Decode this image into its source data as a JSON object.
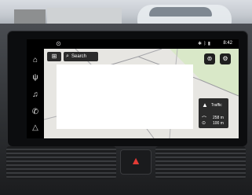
{
  "status_bar": {
    "time": "8:42",
    "icons": [
      "wifi-icon",
      "bluetooth-icon",
      "signal-icon"
    ]
  },
  "side_rail": {
    "items": [
      {
        "icon": "home-icon"
      },
      {
        "icon": "radio-icon"
      },
      {
        "icon": "music-icon"
      },
      {
        "icon": "phone-icon"
      },
      {
        "icon": "navigation-icon"
      }
    ]
  },
  "map": {
    "menu_icon": "grid-menu-icon",
    "search_label": "Search",
    "top_right_buttons": [
      "map-options-icon",
      "settings-icon"
    ]
  },
  "traffic": {
    "label": "Traffic",
    "distance_1": "258 m",
    "distance_2": "100 m"
  },
  "colors": {
    "map_bg": "#e7e6e2",
    "hazard": "#e23b35"
  }
}
